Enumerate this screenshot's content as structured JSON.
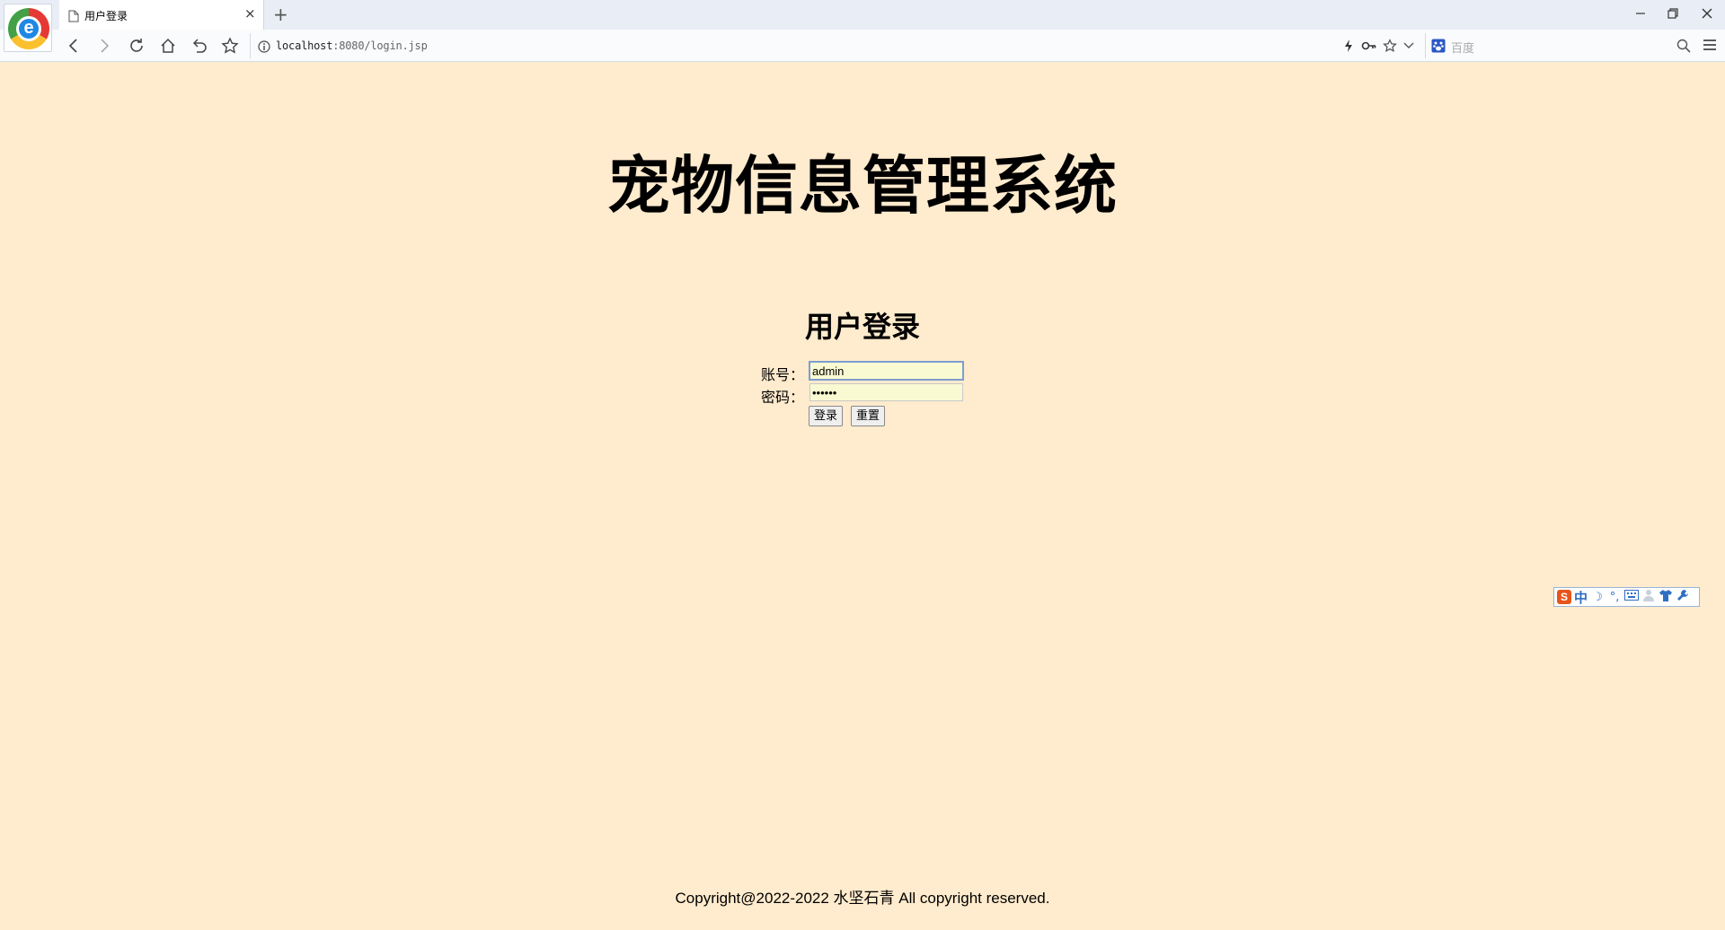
{
  "browser": {
    "tab_title": "用户登录",
    "tab_close": "×",
    "new_tab": "+",
    "url_host": "localhost",
    "url_path": ":8080/login.jsp",
    "search_engine": "百度",
    "logo_letter": "e"
  },
  "page": {
    "main_title": "宠物信息管理系统",
    "login_title": "用户登录",
    "account_label": "账号：",
    "account_value": "admin",
    "password_label": "密码：",
    "password_value": "••••••",
    "login_button": "登录",
    "reset_button": "重置",
    "copyright": "Copyright@2022-2022 水坚石青 All copyright reserved."
  },
  "ime": {
    "logo": "S",
    "lang": "中",
    "moon": "☽",
    "punct": "°,",
    "tshirt": "👕"
  },
  "colors": {
    "page_background": "#ffebcd",
    "input_background": "#fafad2"
  }
}
